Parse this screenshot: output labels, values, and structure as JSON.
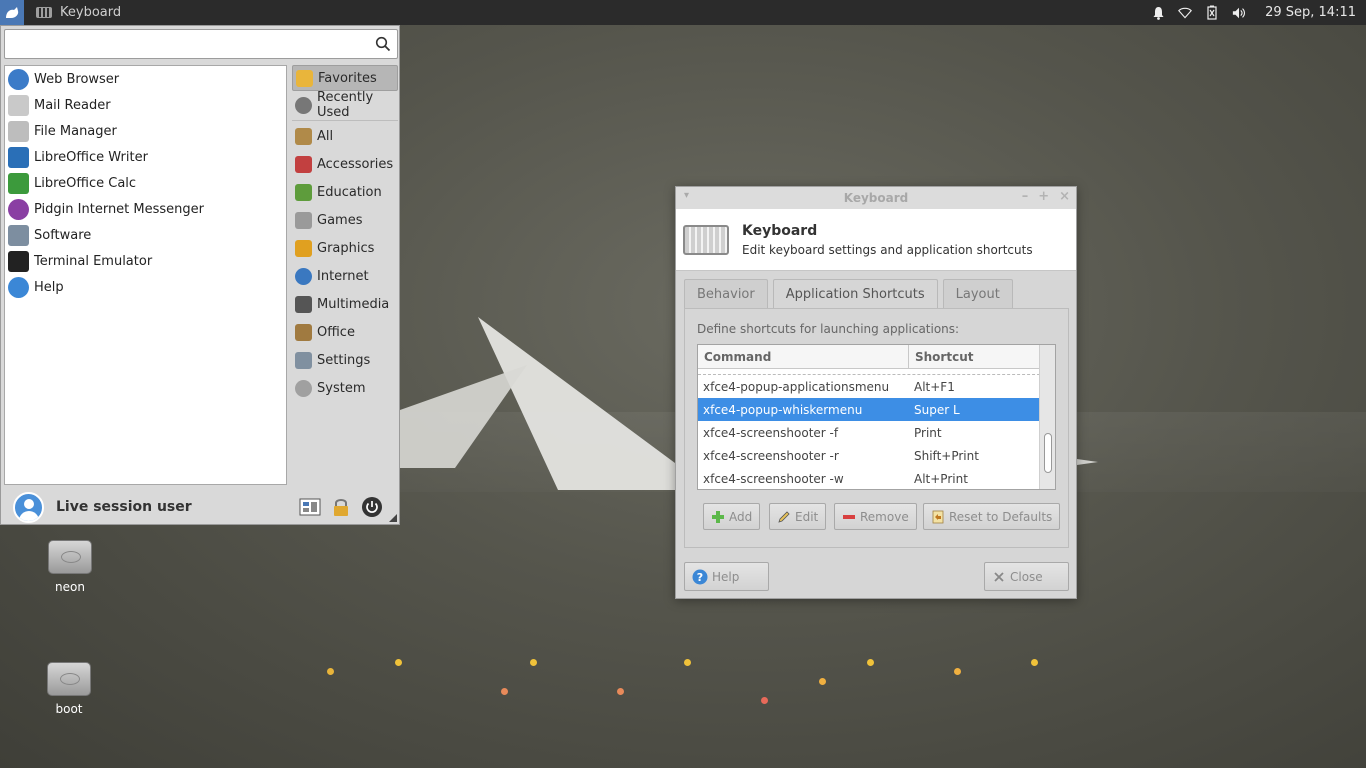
{
  "topbar": {
    "window_title": "Keyboard",
    "clock": "29 Sep, 14:11"
  },
  "whisker": {
    "search": {
      "value": "",
      "placeholder": ""
    },
    "favorites": [
      {
        "label": "Web Browser",
        "icon": "web-browser-icon",
        "color": "#3b7bc8"
      },
      {
        "label": "Mail Reader",
        "icon": "mail-reader-icon",
        "color": "#c9c9c9"
      },
      {
        "label": "File Manager",
        "icon": "file-manager-icon",
        "color": "#bdbdbd"
      },
      {
        "label": "LibreOffice Writer",
        "icon": "writer-icon",
        "color": "#2a6fb7"
      },
      {
        "label": "LibreOffice Calc",
        "icon": "calc-icon",
        "color": "#3c9a3c"
      },
      {
        "label": "Pidgin Internet Messenger",
        "icon": "pidgin-icon",
        "color": "#8a3fa3"
      },
      {
        "label": "Software",
        "icon": "software-icon",
        "color": "#7d8ea0"
      },
      {
        "label": "Terminal Emulator",
        "icon": "terminal-icon",
        "color": "#222222"
      },
      {
        "label": "Help",
        "icon": "help-icon",
        "color": "#3b87d6"
      }
    ],
    "categories": [
      {
        "label": "Favorites",
        "icon": "star-icon",
        "color": "#e9b53b"
      },
      {
        "label": "Recently Used",
        "icon": "recent-icon",
        "color": "#777777"
      },
      {
        "label": "All",
        "icon": "all-apps-icon",
        "color": "#b08a49"
      },
      {
        "label": "Accessories",
        "icon": "accessories-icon",
        "color": "#c24040"
      },
      {
        "label": "Education",
        "icon": "education-icon",
        "color": "#5e9c3c"
      },
      {
        "label": "Games",
        "icon": "games-icon",
        "color": "#9a9a9a"
      },
      {
        "label": "Graphics",
        "icon": "graphics-icon",
        "color": "#e0a020"
      },
      {
        "label": "Internet",
        "icon": "internet-icon",
        "color": "#3a78c0"
      },
      {
        "label": "Multimedia",
        "icon": "multimedia-icon",
        "color": "#555555"
      },
      {
        "label": "Office",
        "icon": "office-icon",
        "color": "#a07a40"
      },
      {
        "label": "Settings",
        "icon": "settings-icon",
        "color": "#8090a0"
      },
      {
        "label": "System",
        "icon": "system-icon",
        "color": "#a0a0a0"
      }
    ],
    "username": "Live session user"
  },
  "desktop": {
    "icons": [
      {
        "label": "neon",
        "icon": "drive-icon"
      },
      {
        "label": "boot",
        "icon": "drive-icon"
      }
    ]
  },
  "dialog": {
    "window_title": "Keyboard",
    "header_title": "Keyboard",
    "header_subtitle": "Edit keyboard settings and application shortcuts",
    "tabs": [
      {
        "label": "Behavior"
      },
      {
        "label": "Application Shortcuts"
      },
      {
        "label": "Layout"
      }
    ],
    "active_tab": "Application Shortcuts",
    "description": "Define shortcuts for launching applications:",
    "columns": {
      "command": "Command",
      "shortcut": "Shortcut"
    },
    "rows": [
      {
        "command": "xfce4-popup-applicationsmenu",
        "shortcut": "Alt+F1",
        "selected": false
      },
      {
        "command": "xfce4-popup-whiskermenu",
        "shortcut": "Super L",
        "selected": true
      },
      {
        "command": "xfce4-screenshooter -f",
        "shortcut": "Print",
        "selected": false
      },
      {
        "command": "xfce4-screenshooter -r",
        "shortcut": "Shift+Print",
        "selected": false
      },
      {
        "command": "xfce4-screenshooter -w",
        "shortcut": "Alt+Print",
        "selected": false
      }
    ],
    "buttons": {
      "add": "Add",
      "edit": "Edit",
      "remove": "Remove",
      "reset": "Reset to Defaults",
      "help": "Help",
      "close": "Close"
    }
  }
}
